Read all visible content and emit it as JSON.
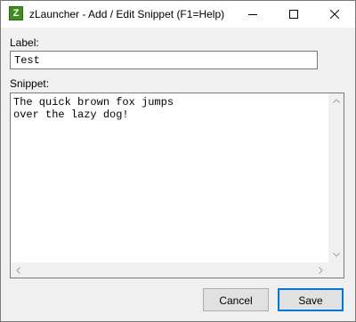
{
  "window": {
    "title": "zLauncher - Add / Edit Snippet (F1=Help)",
    "app_icon_letter": "Z"
  },
  "form": {
    "label_caption": "Label:",
    "label_value": "Test",
    "snippet_caption": "Snippet:",
    "snippet_value": "The quick brown fox jumps\nover the lazy dog!"
  },
  "buttons": {
    "cancel": "Cancel",
    "save": "Save"
  },
  "colors": {
    "accent": "#0078d7",
    "app_icon": "#3f8f1e"
  }
}
